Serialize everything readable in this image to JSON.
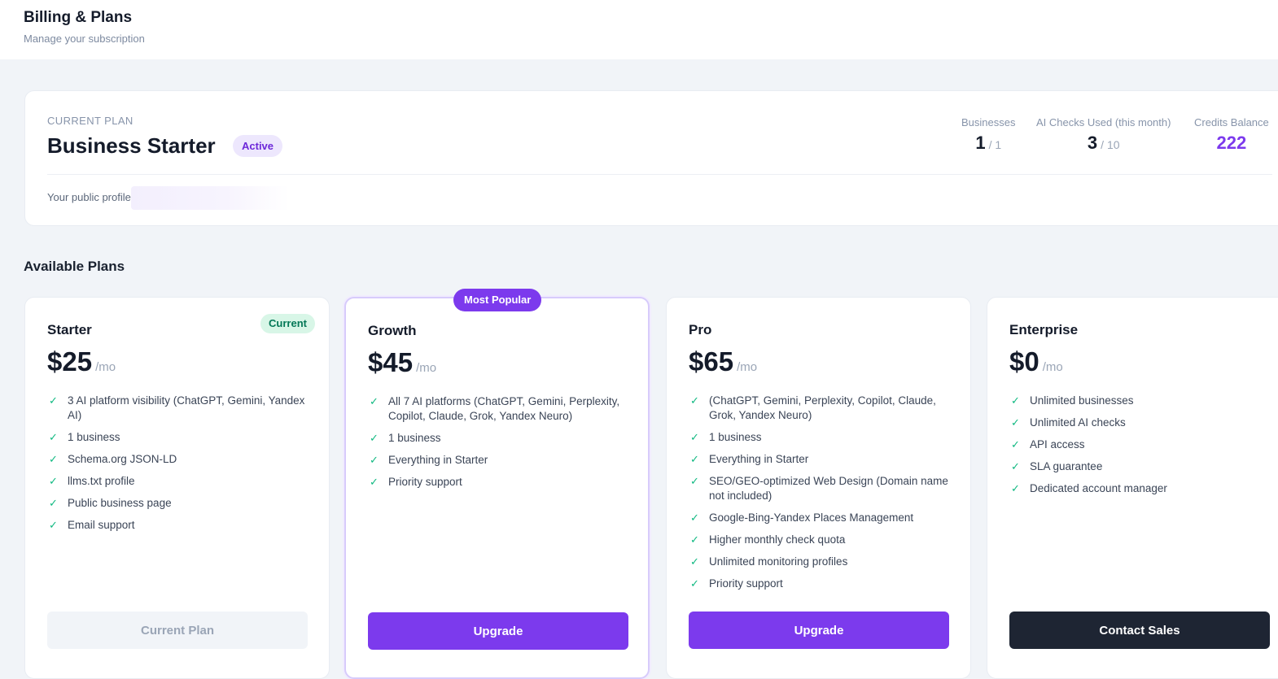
{
  "header": {
    "title": "Billing & Plans",
    "subtitle": "Manage your subscription"
  },
  "current_plan": {
    "kicker": "CURRENT PLAN",
    "name": "Business Starter",
    "status": "Active",
    "public_profile_label": "Your public profile",
    "stats": [
      {
        "label": "Businesses",
        "value": "1",
        "of": "/ 1"
      },
      {
        "label": "AI Checks Used (this month)",
        "value": "3",
        "of": "/ 10"
      },
      {
        "label": "Credits Balance",
        "value": "222",
        "of": ""
      }
    ]
  },
  "section_title": "Available Plans",
  "colors": {
    "accent": "#7c3aed",
    "dark_button": "#1e2533",
    "check": "#10b981",
    "current_badge_bg": "#d8f6e7"
  },
  "plans": [
    {
      "name": "Starter",
      "price": "$25",
      "per": "/mo",
      "tag": "Current",
      "features": [
        "3 AI platform visibility (ChatGPT, Gemini, Yandex AI)",
        "1 business",
        "Schema.org JSON-LD",
        "llms.txt profile",
        "Public business page",
        "Email support"
      ],
      "button": "Current Plan"
    },
    {
      "name": "Growth",
      "price": "$45",
      "per": "/mo",
      "tag": "Most Popular",
      "features": [
        "All 7 AI platforms (ChatGPT, Gemini, Perplexity, Copilot, Claude, Grok, Yandex Neuro)",
        "1 business",
        "Everything in Starter",
        "Priority support"
      ],
      "button": "Upgrade"
    },
    {
      "name": "Pro",
      "price": "$65",
      "per": "/mo",
      "features": [
        "(ChatGPT, Gemini, Perplexity, Copilot, Claude, Grok, Yandex Neuro)",
        "1 business",
        "Everything in Starter",
        "SEO/GEO-optimized Web Design (Domain name not included)",
        "Google-Bing-Yandex Places Management",
        "Higher monthly check quota",
        "Unlimited monitoring profiles",
        "Priority support"
      ],
      "button": "Upgrade"
    },
    {
      "name": "Enterprise",
      "price": "$0",
      "per": "/mo",
      "features": [
        "Unlimited businesses",
        "Unlimited AI checks",
        "API access",
        "SLA guarantee",
        "Dedicated account manager"
      ],
      "button": "Contact Sales"
    }
  ]
}
